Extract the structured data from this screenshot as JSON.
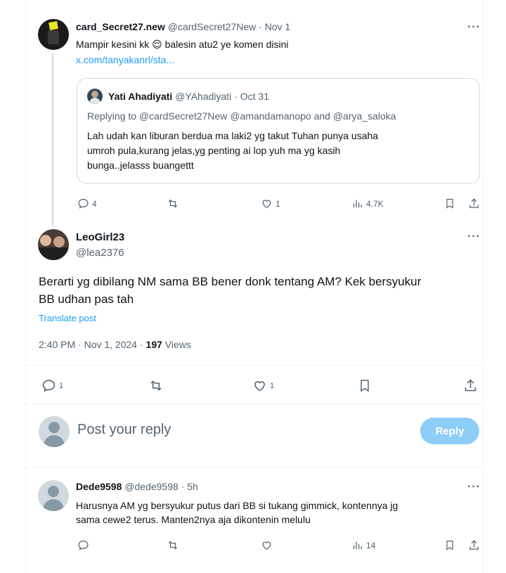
{
  "tweet1": {
    "display_name": "card_Secret27.new",
    "handle": "@cardSecret27New",
    "time": "Nov 1",
    "text_line1": "Mampir kesini kk",
    "emoji": "😌",
    "text_line1_rest": "balesin atu2 ye komen disini",
    "link": "x.com/tanyakanrl/sta...",
    "quote": {
      "display_name": "Yati Ahadiyati",
      "handle": "@YAhadiyati",
      "time": "Oct 31",
      "replying_to": "Replying to @cardSecret27New @amandamanopo and @arya_saloka",
      "line1": "Lah udah kan liburan berdua ma laki2 yg takut Tuhan punya usaha",
      "line2": "umroh pula,kurang jelas,yg penting ai lop yuh ma yg kasih",
      "line3": "bunga..jelasss buangettt"
    },
    "replies": "4",
    "likes": "1",
    "views": "4.7K"
  },
  "main": {
    "display_name": "LeoGirl23",
    "handle": "@lea2376",
    "text_line1": "Berarti yg dibilang NM sama BB bener donk tentang AM? Kek bersyukur",
    "text_line2": "BB udhan pas tah",
    "translate": "Translate post",
    "timestamp": "2:40 PM · Nov 1, 2024 · ",
    "views_count": "197",
    "views_label": " Views",
    "replies": "1",
    "likes": "1"
  },
  "composer": {
    "placeholder": "Post your reply",
    "button": "Reply"
  },
  "tweet3": {
    "display_name": "Dede9598",
    "handle": "@dede9598",
    "time": "5h",
    "line1": "Harusnya AM yg bersyukur putus dari BB si tukang gimmick, kontennya jg",
    "line2": "sama cewe2 terus. Manten2nya aja dikontenin melulu",
    "views": "14"
  },
  "more_glyph": "···",
  "colors": {
    "accent": "#1d9bf0",
    "muted": "#536471",
    "reply_disabled": "#8ecdf8"
  }
}
